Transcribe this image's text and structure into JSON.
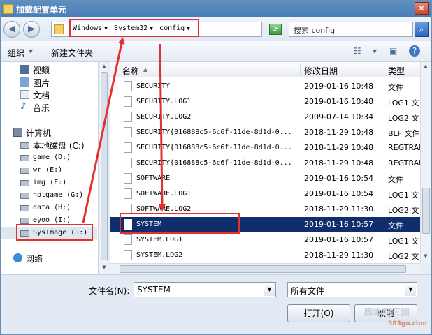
{
  "window": {
    "title": "加载配置单元"
  },
  "address": {
    "crumbs": [
      "Windows",
      "System32",
      "config"
    ],
    "search_placeholder": "搜索 config"
  },
  "toolbar": {
    "organize": "组织",
    "new_folder": "新建文件夹"
  },
  "nav": {
    "items": [
      {
        "label": "视频",
        "icon": "video-folder-icon"
      },
      {
        "label": "图片",
        "icon": "picture-folder-icon"
      },
      {
        "label": "文档",
        "icon": "document-folder-icon"
      },
      {
        "label": "音乐",
        "icon": "music-folder-icon"
      },
      {
        "label": "计算机",
        "icon": "computer-icon"
      },
      {
        "label": "本地磁盘 (C:)",
        "icon": "drive-icon"
      },
      {
        "label": "game (D:)",
        "icon": "drive-icon"
      },
      {
        "label": "wr (E:)",
        "icon": "drive-icon"
      },
      {
        "label": "img (F:)",
        "icon": "drive-icon"
      },
      {
        "label": "hotgame (G:)",
        "icon": "drive-icon"
      },
      {
        "label": "data (H:)",
        "icon": "drive-icon"
      },
      {
        "label": "eyoo (I:)",
        "icon": "drive-icon"
      },
      {
        "label": "SysImage (J:)",
        "icon": "drive-icon"
      },
      {
        "label": "网络",
        "icon": "network-icon"
      }
    ]
  },
  "list": {
    "columns": {
      "name": "名称",
      "modified": "修改日期",
      "type": "类型"
    },
    "rows": [
      {
        "name": "SECURITY",
        "date": "2019-01-16 10:48",
        "type": "文件"
      },
      {
        "name": "SECURITY.LOG1",
        "date": "2019-01-16 10:48",
        "type": "LOG1 文"
      },
      {
        "name": "SECURITY.LOG2",
        "date": "2009-07-14 10:34",
        "type": "LOG2 文"
      },
      {
        "name": "SECURITY{016888c5-6c6f-11de-8d1d-0...",
        "date": "2018-11-29 10:48",
        "type": "BLF 文件"
      },
      {
        "name": "SECURITY{016888c5-6c6f-11de-8d1d-0...",
        "date": "2018-11-29 10:48",
        "type": "REGTRAN"
      },
      {
        "name": "SECURITY{016888c5-6c6f-11de-8d1d-0...",
        "date": "2018-11-29 10:48",
        "type": "REGTRAN"
      },
      {
        "name": "SOFTWARE",
        "date": "2019-01-16 10:54",
        "type": "文件"
      },
      {
        "name": "SOFTWARE.LOG1",
        "date": "2019-01-16 10:54",
        "type": "LOG1 文"
      },
      {
        "name": "SOFTWARE.LOG2",
        "date": "2018-11-29 11:30",
        "type": "LOG2 文"
      },
      {
        "name": "SYSTEM",
        "date": "2019-01-16 10:57",
        "type": "文件"
      },
      {
        "name": "SYSTEM.LOG1",
        "date": "2019-01-16 10:57",
        "type": "LOG1 文"
      },
      {
        "name": "SYSTEM.LOG2",
        "date": "2018-11-29 11:30",
        "type": "LOG2 文"
      }
    ],
    "selected_index": 9
  },
  "footer": {
    "filename_label": "文件名(N):",
    "filename_value": "SYSTEM",
    "filter_value": "所有文件",
    "open_button": "打开(O)",
    "cancel_button": "取消"
  },
  "watermark": {
    "text": "脚本吧三国",
    "site": "583go.com"
  },
  "colors": {
    "selection": "#0f2e6b",
    "annotation": "#e53030",
    "titlebar": "#4a7db6"
  }
}
